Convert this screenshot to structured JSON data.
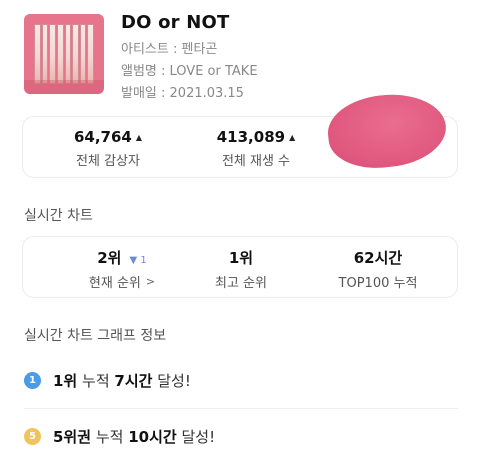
{
  "song": {
    "title": "DO or NOT",
    "artist_line": "아티스트 : 펜타곤",
    "album_line": "앨범명 : LOVE or TAKE",
    "release_line": "발매일 : 2021.03.15"
  },
  "stats": {
    "listeners_value": "64,764",
    "listeners_label": "전체 감상자",
    "plays_value": "413,089",
    "plays_label": "전체 재생 수",
    "up_icon": "triangle-up-icon"
  },
  "realtime": {
    "section_title": "실시간 차트",
    "current_rank": "2위",
    "current_change": "1",
    "current_label": "현재 순위",
    "best_rank": "1위",
    "best_label": "최고 순위",
    "top100_hours": "62시간",
    "top100_label": "TOP100 누적"
  },
  "graph": {
    "section_title": "실시간 차트 그래프 정보"
  },
  "achievements": [
    {
      "badge": "1",
      "rank": "1위",
      "middle": "누적",
      "hours": "7시간",
      "suffix": "달성!",
      "color": "#4b9be8"
    },
    {
      "badge": "5",
      "rank": "5위권",
      "middle": "누적",
      "hours": "10시간",
      "suffix": "달성!",
      "color": "#f0c45a"
    }
  ],
  "colors": {
    "redaction_blob": "#e15a80",
    "rank_change": "#6c8bd9"
  }
}
